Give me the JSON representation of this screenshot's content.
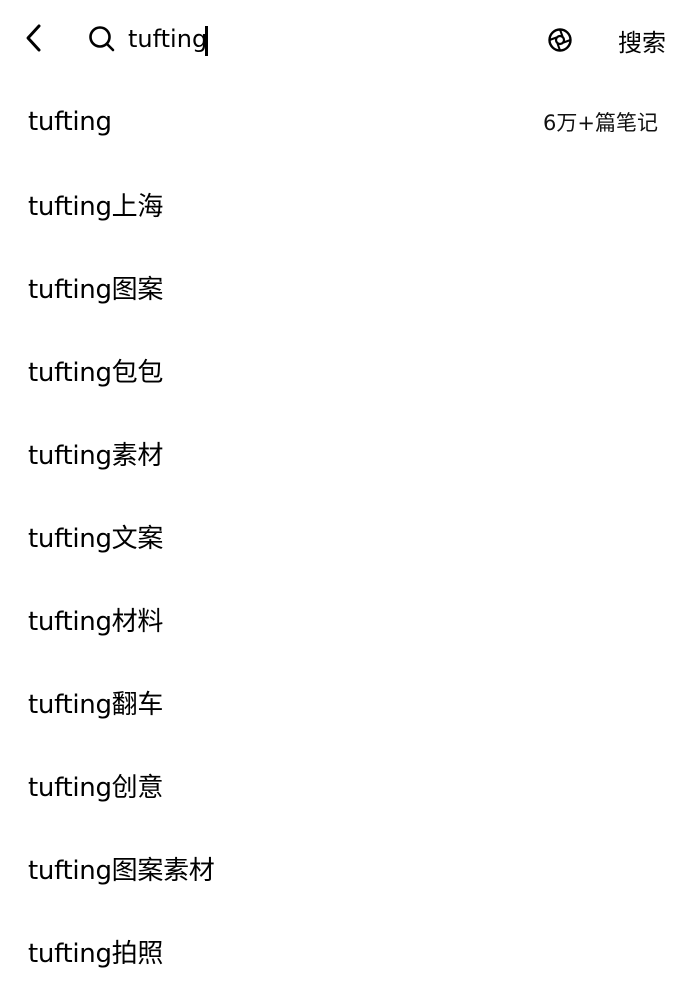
{
  "header": {
    "back_icon": "chevron-left-icon",
    "search_icon": "search-icon",
    "search_value": "tufting",
    "camera_icon": "camera-icon",
    "search_button_label": "搜索"
  },
  "suggestions": [
    {
      "text": "tufting",
      "meta": "6万+篇笔记"
    },
    {
      "text": "tufting上海",
      "meta": ""
    },
    {
      "text": "tufting图案",
      "meta": ""
    },
    {
      "text": "tufting包包",
      "meta": ""
    },
    {
      "text": "tufting素材",
      "meta": ""
    },
    {
      "text": "tufting文案",
      "meta": ""
    },
    {
      "text": "tufting材料",
      "meta": ""
    },
    {
      "text": "tufting翻车",
      "meta": ""
    },
    {
      "text": "tufting创意",
      "meta": ""
    },
    {
      "text": "tufting图案素材",
      "meta": ""
    },
    {
      "text": "tufting拍照",
      "meta": ""
    }
  ]
}
